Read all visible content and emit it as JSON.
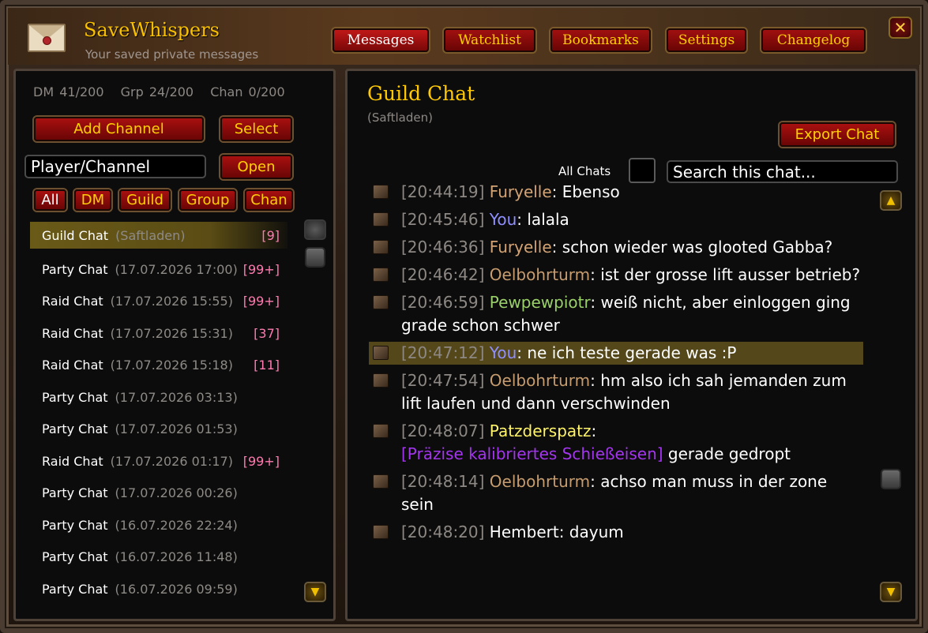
{
  "app": {
    "title": "SaveWhispers",
    "subtitle": "Your saved private messages"
  },
  "nav": {
    "messages": "Messages",
    "watchlist": "Watchlist",
    "bookmarks": "Bookmarks",
    "settings": "Settings",
    "changelog": "Changelog",
    "close": "✕"
  },
  "sidebar": {
    "stats": {
      "dm": "DM 41/200",
      "grp": "Grp 24/200",
      "chan": "Chan 0/200"
    },
    "add_channel": "Add Channel",
    "select": "Select",
    "player_channel_value": "Player/Channel",
    "open": "Open",
    "filters": [
      "All",
      "DM",
      "Guild",
      "Group",
      "Chan"
    ],
    "channels": [
      {
        "name": "Guild Chat",
        "date": "(Saftladen)",
        "badge": "[9]"
      },
      {
        "name": "Party Chat",
        "date": "(17.07.2026 17:00)",
        "badge": "[99+]"
      },
      {
        "name": "Raid Chat",
        "date": "(17.07.2026 15:55)",
        "badge": "[99+]"
      },
      {
        "name": "Raid Chat",
        "date": "(17.07.2026 15:31)",
        "badge": "[37]"
      },
      {
        "name": "Raid Chat",
        "date": "(17.07.2026 15:18)",
        "badge": "[11]"
      },
      {
        "name": "Party Chat",
        "date": "(17.07.2026 03:13)",
        "badge": ""
      },
      {
        "name": "Party Chat",
        "date": "(17.07.2026 01:53)",
        "badge": ""
      },
      {
        "name": "Raid Chat",
        "date": "(17.07.2026 01:17)",
        "badge": "[99+]"
      },
      {
        "name": "Party Chat",
        "date": "(17.07.2026 00:26)",
        "badge": ""
      },
      {
        "name": "Party Chat",
        "date": "(16.07.2026 22:24)",
        "badge": ""
      },
      {
        "name": "Party Chat",
        "date": "(16.07.2026 11:48)",
        "badge": ""
      },
      {
        "name": "Party Chat",
        "date": "(16.07.2026 09:59)",
        "badge": ""
      }
    ]
  },
  "chat": {
    "title": "Guild Chat",
    "subtitle": "(Saftladen)",
    "export": "Export Chat",
    "all_chats_label": "All Chats",
    "search_placeholder": "Search this chat...",
    "messages": [
      {
        "time": "[20:44:19]",
        "sender": "Furyelle",
        "text": ": Ebenso"
      },
      {
        "time": "[20:45:46]",
        "sender": "You",
        "text": ": lalala"
      },
      {
        "time": "[20:46:36]",
        "sender": "Furyelle",
        "text": ": schon wieder was glooted Gabba?"
      },
      {
        "time": "[20:46:42]",
        "sender": "Oelbohrturm",
        "text": ": ist der grosse lift ausser betrieb?"
      },
      {
        "time": "[20:46:59]",
        "sender": "Pewpewpiotr",
        "text": ": weiß nicht, aber einloggen ging grade schon schwer"
      },
      {
        "time": "[20:47:12]",
        "sender": "You",
        "text": ": ne ich teste gerade was :P"
      },
      {
        "time": "[20:47:54]",
        "sender": "Oelbohrturm",
        "text": ": hm also ich sah jemanden zum lift laufen und dann verschwinden"
      },
      {
        "time": "[20:48:07]",
        "sender": "Patzderspatz",
        "text": ":",
        "item": "[Präzise kalibriertes Schießeisen]",
        "after": " gerade gedropt"
      },
      {
        "time": "[20:48:14]",
        "sender": "Oelbohrturm",
        "text": ": achso man muss in der zone sein"
      },
      {
        "time": "[20:48:20]",
        "sender": "Hembert",
        "text": ": dayum"
      }
    ]
  }
}
